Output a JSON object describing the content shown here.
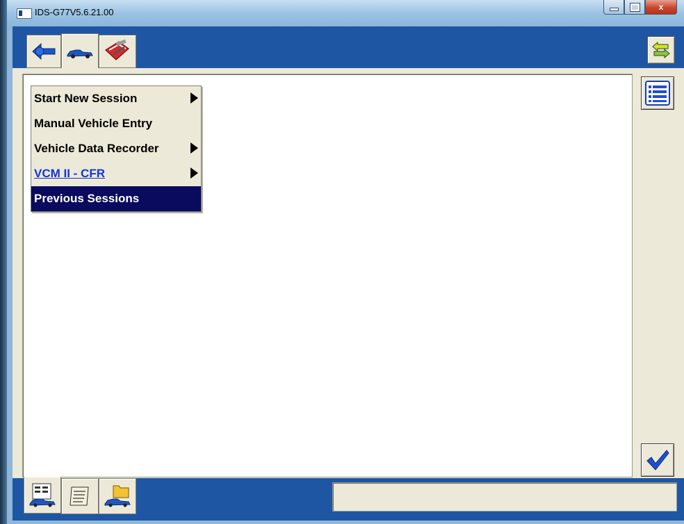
{
  "window": {
    "title": "IDS-G77V5.6.21.00",
    "controls": [
      "minimize-icon",
      "maximize-icon",
      "close-icon"
    ],
    "close_label": "x"
  },
  "top_tabs": [
    {
      "icon": "connect-plug-icon",
      "active": false
    },
    {
      "icon": "vehicle-icon",
      "active": true
    },
    {
      "icon": "toolbox-icon",
      "active": false
    }
  ],
  "menu": {
    "items": [
      {
        "label": "Start New Session",
        "submenu": true,
        "style": "normal"
      },
      {
        "label": "Manual Vehicle Entry",
        "submenu": false,
        "style": "normal"
      },
      {
        "label": "Vehicle Data Recorder",
        "submenu": true,
        "style": "normal"
      },
      {
        "label": "VCM II - CFR",
        "submenu": true,
        "style": "link"
      },
      {
        "label": "Previous Sessions",
        "submenu": false,
        "style": "selected"
      }
    ]
  },
  "side_buttons": [
    {
      "icon": "list-icon"
    },
    {
      "icon": "checkmark-icon"
    }
  ],
  "bottom_tabs": [
    {
      "icon": "vehicle-data-icon",
      "active": true
    },
    {
      "icon": "scroll-document-icon",
      "active": false
    },
    {
      "icon": "vehicle-folder-icon",
      "active": false
    }
  ],
  "status_text": "",
  "colors": {
    "app_blue": "#1e56a4",
    "panel": "#ece9d8",
    "selection": "#0a0a5e",
    "link": "#1233d8"
  }
}
